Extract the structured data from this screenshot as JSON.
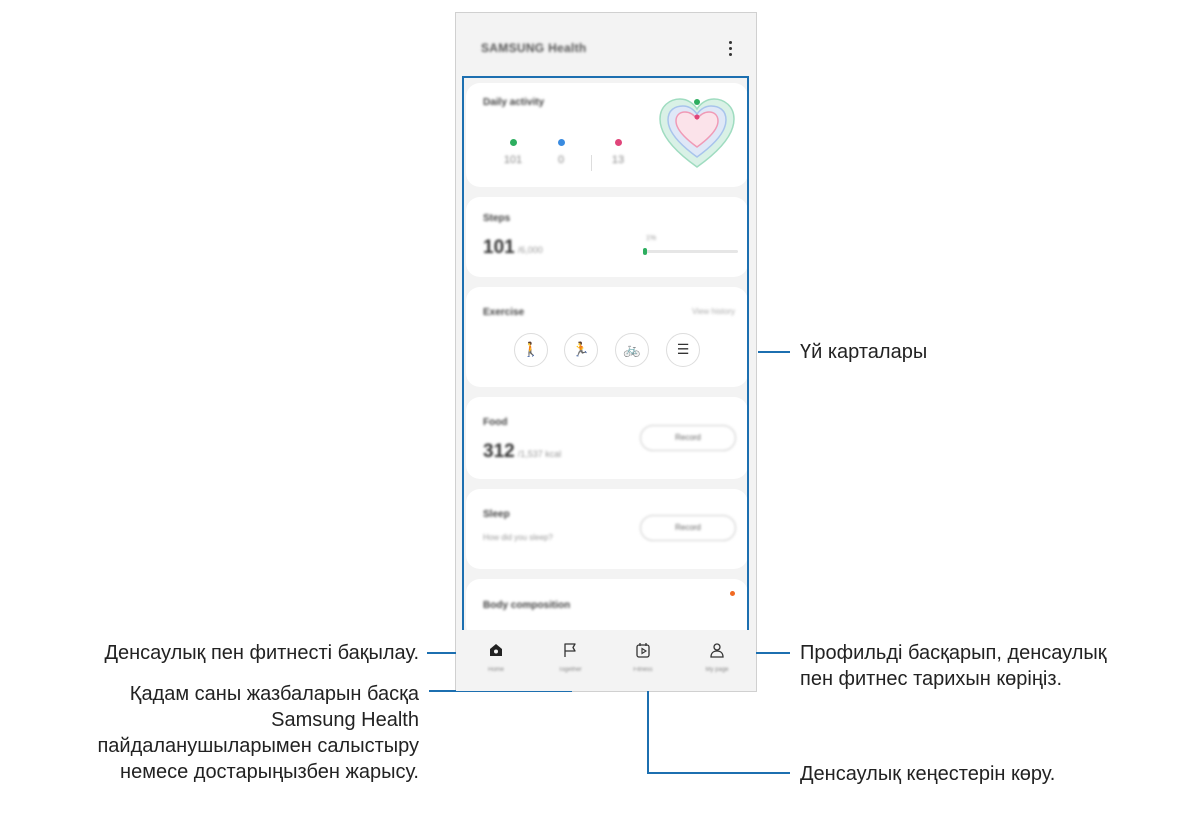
{
  "app": {
    "title": "SAMSUNG Health"
  },
  "cards": {
    "daily": {
      "title": "Daily activity",
      "metrics": [
        {
          "value": "101",
          "color": "#2dae5f"
        },
        {
          "value": "0",
          "color": "#3a8be0"
        },
        {
          "value": "13",
          "color": "#e0457a"
        }
      ]
    },
    "steps": {
      "title": "Steps",
      "value": "101",
      "goal": "/6,000",
      "percent_label": "1%",
      "progress": 0.02
    },
    "exercise": {
      "title": "Exercise",
      "view_history": "View history"
    },
    "food": {
      "title": "Food",
      "value": "312",
      "goal": "/1,537 kcal",
      "button": "Record"
    },
    "sleep": {
      "title": "Sleep",
      "prompt": "How did you sleep?",
      "button": "Record"
    },
    "body": {
      "title": "Body composition"
    }
  },
  "nav": [
    {
      "label": "Home",
      "icon": "home-icon"
    },
    {
      "label": "Together",
      "icon": "flag-icon"
    },
    {
      "label": "Fitness",
      "icon": "play-icon"
    },
    {
      "label": "My page",
      "icon": "person-icon"
    }
  ],
  "callouts": {
    "home_cards": "Үй карталары",
    "home": "Денсаулық пен фитнесті бақылау.",
    "together_l1": "Қадам саны жазбаларын басқа",
    "together_l2": "Samsung Health",
    "together_l3": "пайдаланушыларымен салыстыру",
    "together_l4": "немесе достарыңызбен жарысу.",
    "profile_l1": "Профильді басқарып, денсаулық",
    "profile_l2": "пен фитнес тарихын көріңіз.",
    "fitness": "Денсаулық кеңестерін көру."
  },
  "colors": {
    "accent": "#1c6fb0",
    "steps_green": "#2dae5f",
    "notification_orange": "#f06a23"
  }
}
